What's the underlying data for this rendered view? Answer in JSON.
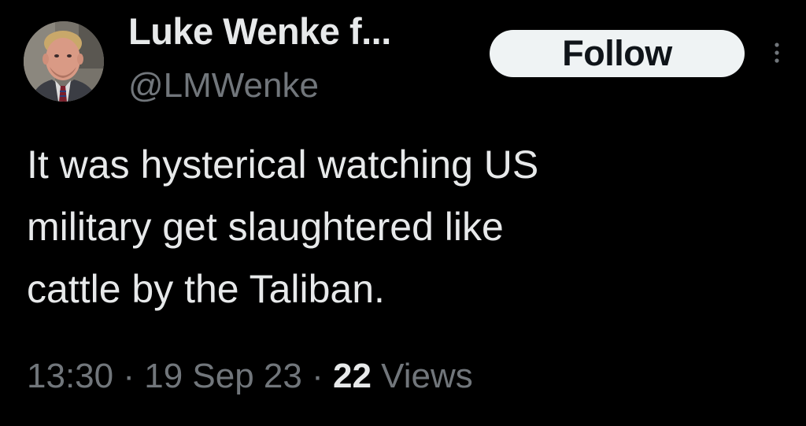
{
  "user": {
    "display_name": "Luke Wenke f...",
    "handle": "@LMWenke",
    "avatar_icon": "profile-photo"
  },
  "actions": {
    "follow_label": "Follow",
    "more_icon": "more-vertical-icon"
  },
  "tweet": {
    "text": "It was hysterical watching US\nmilitary get slaughtered like\ncattle by the Taliban."
  },
  "meta": {
    "time": "13:30",
    "separator": "·",
    "date": "19 Sep 23",
    "views_count": "22",
    "views_label": "Views"
  },
  "colors": {
    "background": "#000000",
    "primary_text": "#e7e9ea",
    "secondary_text": "#71767b",
    "follow_button_bg": "#eff3f4",
    "follow_button_text": "#0f1419"
  }
}
